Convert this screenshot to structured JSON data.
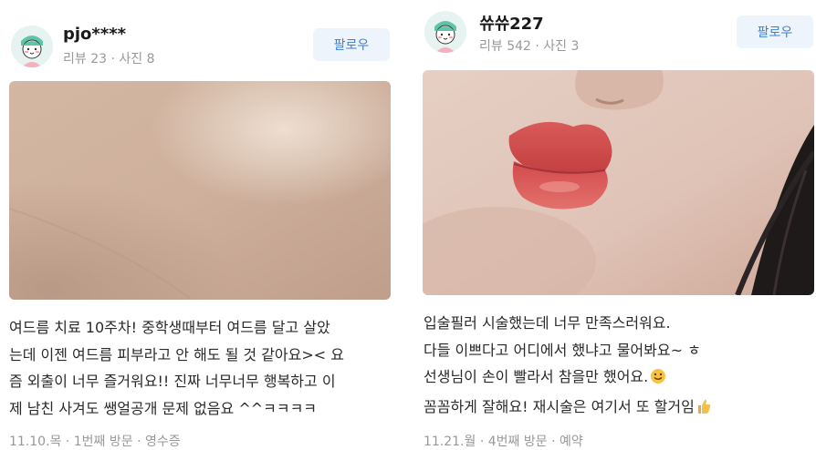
{
  "reviews": [
    {
      "username": "pjo****",
      "review_count_label": "리뷰 23",
      "photo_count_label": "사진 8",
      "follow_label": "팔로우",
      "text_lines": [
        "여드름 치료 10주차! 중학생때부터 여드름 달고 살았",
        "는데 이젠 여드름 피부라고 안 해도 될 것 같아요>< 요",
        "즘 외출이 너무 즐거워요!! 진짜 너무너무 행복하고 이",
        "제 남친 사겨도 쌩얼공개 문제 없음요 ^^ㅋㅋㅋㅋ"
      ],
      "footer": "11.10.목 · 1번째 방문 · 영수증"
    },
    {
      "username": "쓔쓔227",
      "review_count_label": "리뷰 542",
      "photo_count_label": "사진 3",
      "follow_label": "팔로우",
      "text_lines": [
        "입술필러 시술했는데 너무 만족스러워요.",
        "다들 이쁘다고 어디에서 했냐고 물어봐요~ ㅎ",
        "선생님이 손이 빨라서 참을만 했어요.",
        "꼼꼼하게 잘해요! 재시술은 여기서 또 할거임"
      ],
      "emoji_icons": [
        "smile-emoji-icon",
        "thumbs-up-icon"
      ],
      "footer": "11.21.월 · 4번째 방문 · 예약"
    }
  ]
}
